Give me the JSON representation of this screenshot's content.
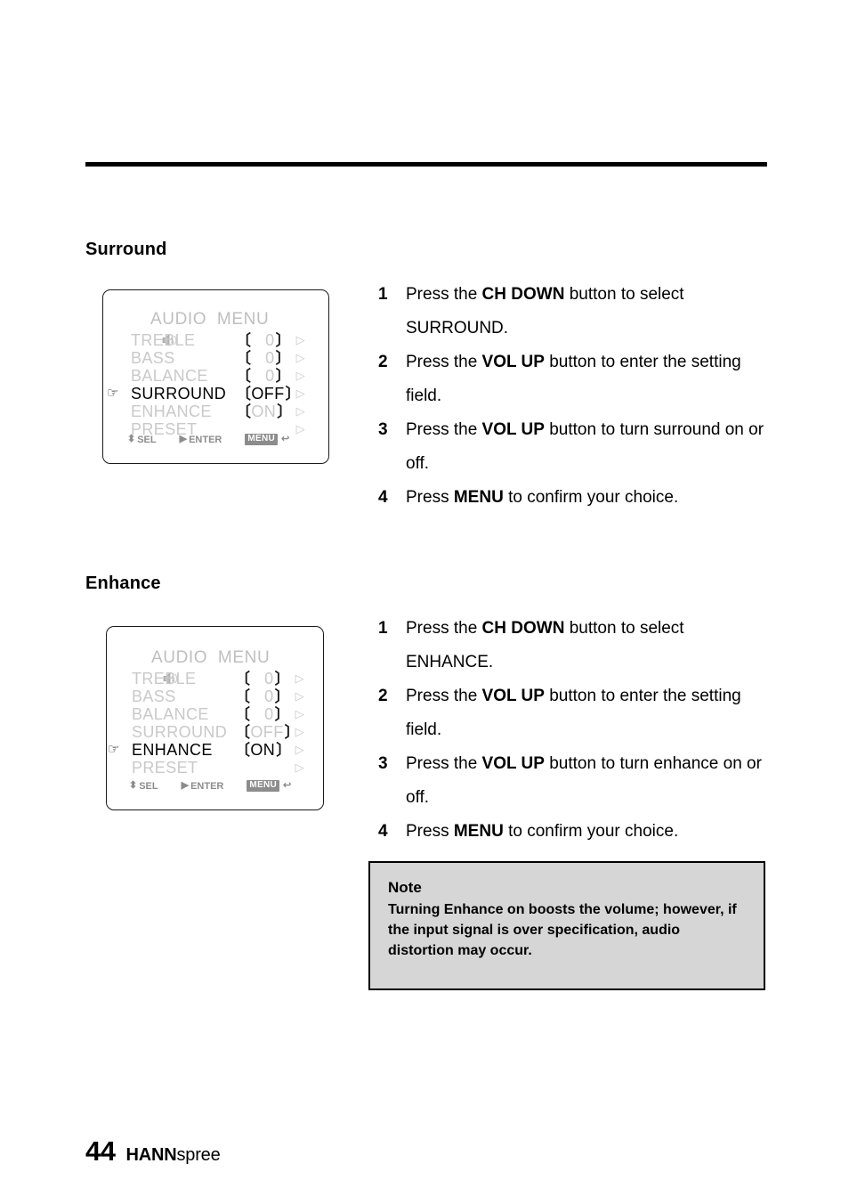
{
  "page": {
    "number": "44",
    "brand_bold": "HANN",
    "brand_light": "spree"
  },
  "sections": [
    {
      "heading": "Surround",
      "osd": {
        "title": "AUDIO  MENU",
        "title_icon": "speaker-icon",
        "cursor_icon": "pointing-hand-icon",
        "rows": [
          {
            "label": "TREBLE",
            "open": "〔",
            "value": "0",
            "close": "〕",
            "arrow": "▷",
            "active": false,
            "has_value": true
          },
          {
            "label": "BASS",
            "open": "〔",
            "value": "0",
            "close": "〕",
            "arrow": "▷",
            "active": false,
            "has_value": true
          },
          {
            "label": "BALANCE",
            "open": "〔",
            "value": "0",
            "close": "〕",
            "arrow": "▷",
            "active": false,
            "has_value": true
          },
          {
            "label": "SURROUND",
            "open": "〔",
            "value": "OFF",
            "close": "〕",
            "arrow": "▷",
            "active": true,
            "has_value": true
          },
          {
            "label": "ENHANCE",
            "open": "〔",
            "value": "ON",
            "close": "〕",
            "arrow": "▷",
            "active": false,
            "has_value": true
          },
          {
            "label": "PRESET",
            "open": "",
            "value": "",
            "close": "",
            "arrow": "▷",
            "active": false,
            "has_value": false
          }
        ],
        "bar": {
          "sel_glyph": "⬍",
          "sel_label": "SEL",
          "enter_glyph": "▶",
          "enter_label": "ENTER",
          "menu_chip": "MENU",
          "back_glyph": "↩"
        }
      },
      "steps": [
        {
          "num": "1",
          "html": "Press the <b>CH DOWN</b> button to select SURROUND."
        },
        {
          "num": "2",
          "html": "Press the <b>VOL UP</b> button to enter the setting field."
        },
        {
          "num": "3",
          "html": "Press the <b>VOL UP</b> button to turn surround on or off."
        },
        {
          "num": "4",
          "html": "Press <b>MENU</b> to confirm your choice."
        }
      ]
    },
    {
      "heading": "Enhance",
      "osd": {
        "title": "AUDIO  MENU",
        "title_icon": "speaker-icon",
        "cursor_icon": "pointing-hand-icon",
        "rows": [
          {
            "label": "TREBLE",
            "open": "〔",
            "value": "0",
            "close": "〕",
            "arrow": "▷",
            "active": false,
            "has_value": true
          },
          {
            "label": "BASS",
            "open": "〔",
            "value": "0",
            "close": "〕",
            "arrow": "▷",
            "active": false,
            "has_value": true
          },
          {
            "label": "BALANCE",
            "open": "〔",
            "value": "0",
            "close": "〕",
            "arrow": "▷",
            "active": false,
            "has_value": true
          },
          {
            "label": "SURROUND",
            "open": "〔",
            "value": "OFF",
            "close": "〕",
            "arrow": "▷",
            "active": false,
            "has_value": true
          },
          {
            "label": "ENHANCE",
            "open": "〔",
            "value": "ON",
            "close": "〕",
            "arrow": "▷",
            "active": true,
            "has_value": true
          },
          {
            "label": "PRESET",
            "open": "",
            "value": "",
            "close": "",
            "arrow": "▷",
            "active": false,
            "has_value": false
          }
        ],
        "bar": {
          "sel_glyph": "⬍",
          "sel_label": "SEL",
          "enter_glyph": "▶",
          "enter_label": "ENTER",
          "menu_chip": "MENU",
          "back_glyph": "↩"
        }
      },
      "steps": [
        {
          "num": "1",
          "html": "Press the <b>CH DOWN</b> button to select ENHANCE."
        },
        {
          "num": "2",
          "html": "Press the <b>VOL UP</b> button to enter the setting field."
        },
        {
          "num": "3",
          "html": "Press the <b>VOL UP</b> button to turn enhance on or off."
        },
        {
          "num": "4",
          "html": "Press <b>MENU</b> to confirm your choice."
        }
      ]
    }
  ],
  "note": {
    "title": "Note",
    "body": "Turning Enhance on boosts the volume; however, if the input signal is over specification, audio distortion may occur."
  },
  "colors": {
    "osd_dim_text": "#c9c9c9",
    "osd_active_text": "#000000",
    "osd_bar_text": "#8c8c8c",
    "note_background": "#d6d6d6",
    "rule": "#000000"
  }
}
